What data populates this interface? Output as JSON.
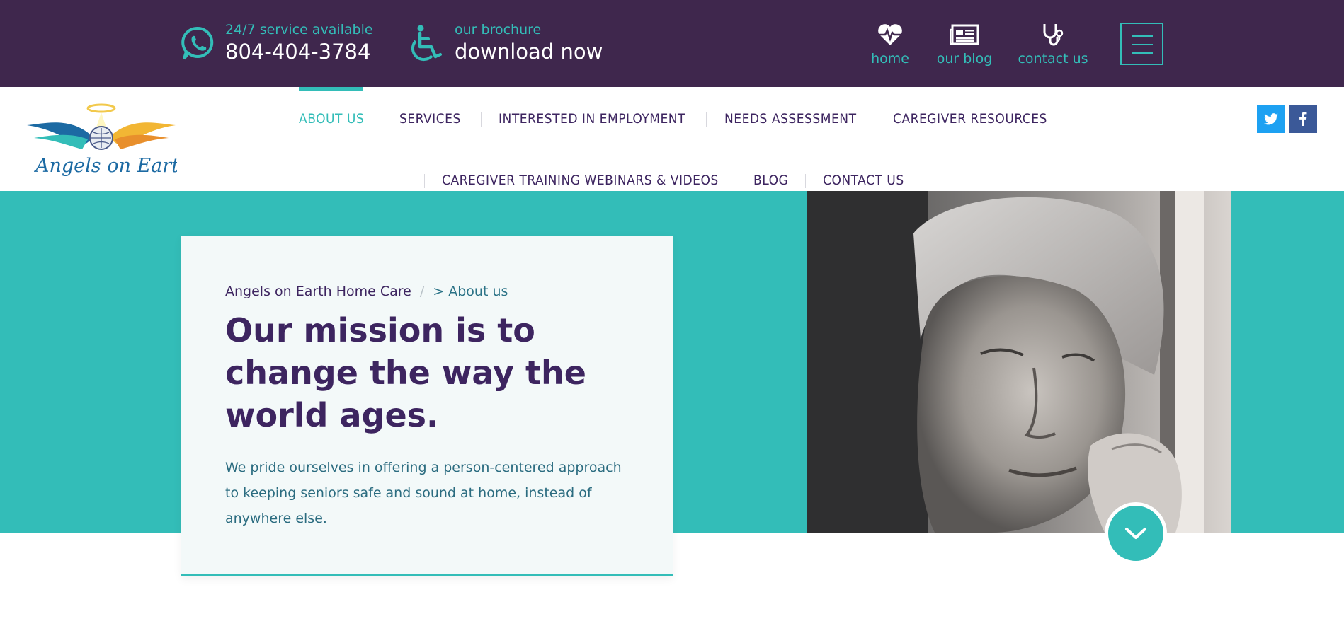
{
  "topbar": {
    "phone": {
      "small": "24/7 service available",
      "big": "804-404-3784",
      "icon": "whatsapp-phone-icon"
    },
    "brochure": {
      "small": "our brochure",
      "big": "download now",
      "icon": "wheelchair-icon"
    },
    "quicklinks": [
      {
        "label": "home",
        "icon": "heartbeat-icon"
      },
      {
        "label": "our blog",
        "icon": "newspaper-icon"
      },
      {
        "label": "contact us",
        "icon": "stethoscope-icon"
      }
    ],
    "menu_icon": "hamburger-menu-icon"
  },
  "logo": {
    "text": "Angels on Earth"
  },
  "nav": {
    "row1": [
      "ABOUT US",
      "SERVICES",
      "INTERESTED IN EMPLOYMENT",
      "NEEDS ASSESSMENT",
      "CAREGIVER RESOURCES"
    ],
    "row2": [
      "CAREGIVER TRAINING WEBINARS & VIDEOS",
      "BLOG",
      "CONTACT US"
    ],
    "active": "ABOUT US"
  },
  "social": {
    "twitter_icon": "twitter-icon",
    "facebook_icon": "facebook-icon"
  },
  "hero": {
    "breadcrumb": {
      "home": "Angels on Earth Home Care",
      "separator": "/",
      "current": "> About us"
    },
    "title": "Our mission is to change the way the world ages.",
    "text": "We pride ourselves in offering a person-centered approach to keeping seniors safe and sound at home, instead of anywhere else.",
    "scroll_icon": "chevron-down-icon"
  },
  "colors": {
    "purple": "#3f274d",
    "teal": "#33bdb8",
    "nav_text": "#3d2560"
  }
}
